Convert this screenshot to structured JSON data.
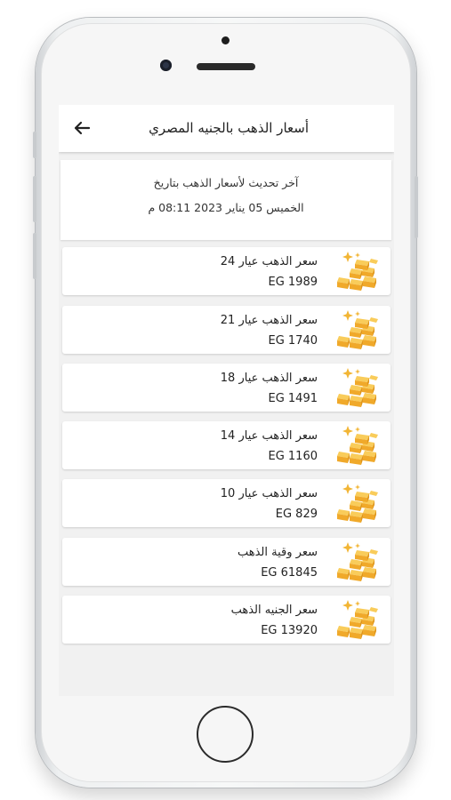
{
  "header": {
    "title": "أسعار الذهب بالجنيه المصري",
    "back_icon": "arrow-back-icon"
  },
  "update": {
    "line1": "آخر تحديث لأسعار الذهب بتاريخ",
    "line2": "الخميس 05 يناير 2023 08:11 م"
  },
  "items": [
    {
      "name": "سعر الذهب عيار 24",
      "price": "EG 1989",
      "icon": "gold-bars-icon"
    },
    {
      "name": "سعر الذهب عيار 21",
      "price": "EG 1740",
      "icon": "gold-bars-icon"
    },
    {
      "name": "سعر الذهب عيار 18",
      "price": "EG 1491",
      "icon": "gold-bars-icon"
    },
    {
      "name": "سعر الذهب عيار 14",
      "price": "EG 1160",
      "icon": "gold-bars-icon"
    },
    {
      "name": "سعر الذهب عيار 10",
      "price": "EG 829",
      "icon": "gold-bars-icon"
    },
    {
      "name": "سعر وقية الذهب",
      "price": "EG 61845",
      "icon": "gold-bars-icon"
    },
    {
      "name": "سعر الجنيه الذهب",
      "price": "EG 13920",
      "icon": "gold-bars-icon"
    }
  ],
  "colors": {
    "gold": "#f3b233",
    "gold_dark": "#e29a1b",
    "gold_light": "#f9cc5a",
    "background": "#f1f1f1"
  }
}
